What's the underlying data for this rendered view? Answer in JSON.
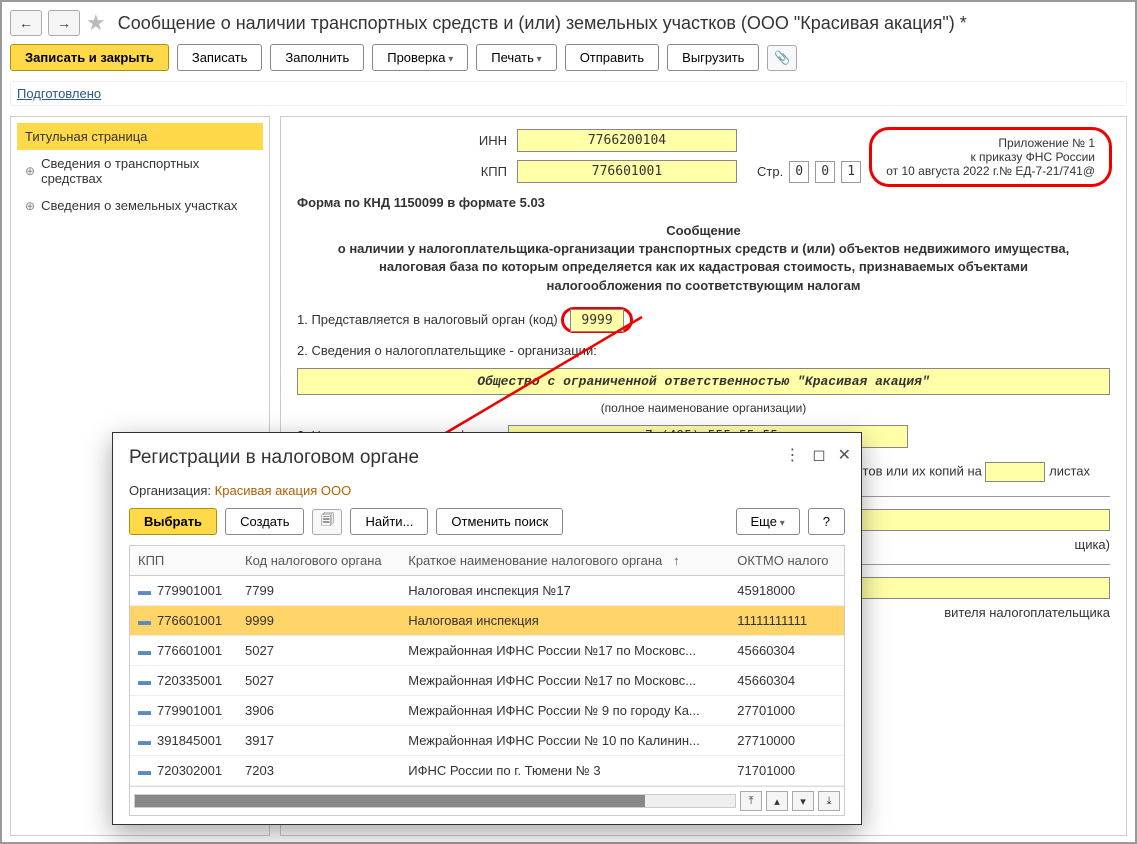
{
  "header": {
    "title": "Сообщение о наличии транспортных средств и (или) земельных участков (ООО \"Красивая акация\") *"
  },
  "toolbar": {
    "save_close": "Записать и закрыть",
    "save": "Записать",
    "fill": "Заполнить",
    "check": "Проверка",
    "print": "Печать",
    "send": "Отправить",
    "export": "Выгрузить"
  },
  "status": "Подготовлено",
  "sidebar": {
    "items": [
      {
        "label": "Титульная страница"
      },
      {
        "label": "Сведения о транспортных средствах"
      },
      {
        "label": "Сведения о земельных участках"
      }
    ]
  },
  "form": {
    "inn_label": "ИНН",
    "inn": "7766200104",
    "kpp_label": "КПП",
    "kpp": "776601001",
    "page_label": "Стр.",
    "page_digits": [
      "0",
      "0",
      "1"
    ],
    "annex": {
      "l1": "Приложение № 1",
      "l2": "к приказу ФНС России",
      "l3": "от 10 августа 2022 г.№ ЕД-7-21/741@"
    },
    "knd": "Форма по КНД 1150099 в формате 5.03",
    "heading": "Сообщение",
    "subtitle": "о наличии у налогоплательщика-организации транспортных средств и (или) объектов недвижимого имущества, налоговая база по которым определяется как их кадастровая стоимость, признаваемых объектами налогообложения по соответствующим налогам",
    "line1_label": "1. Представляется в налоговый орган (код)",
    "tax_code": "9999",
    "line2_label": "2. Сведения о налогоплательщике - организации:",
    "org_full": "Общество с ограниченной ответственностью \"Красивая акация\"",
    "org_note": "(полное наименование организации)",
    "line3_label": "3. Номер контактного телефона",
    "phone": "+7 (495) 555-55-55",
    "sheets_suffix": "нтов или их копий на",
    "sheets_unit": "листах",
    "rep_suffix1": "щика)",
    "rep_suffix2": "вителя налогоплательщика"
  },
  "modal": {
    "title": "Регистрации в налоговом органе",
    "org_label": "Организация:",
    "org_name": "Красивая акация ООО",
    "btn_select": "Выбрать",
    "btn_create": "Создать",
    "btn_find": "Найти...",
    "btn_cancel": "Отменить поиск",
    "btn_more": "Еще",
    "columns": [
      "КПП",
      "Код налогового органа",
      "Краткое наименование налогового органа",
      "ОКТМО налого"
    ],
    "rows": [
      {
        "kpp": "779901001",
        "code": "7799",
        "name": "Налоговая инспекция №17",
        "oktmo": "45918000"
      },
      {
        "kpp": "776601001",
        "code": "9999",
        "name": "Налоговая инспекция",
        "oktmo": "11111111111"
      },
      {
        "kpp": "776601001",
        "code": "5027",
        "name": "Межрайонная ИФНС России №17 по Московс...",
        "oktmo": "45660304"
      },
      {
        "kpp": "720335001",
        "code": "5027",
        "name": "Межрайонная ИФНС России №17 по Московс...",
        "oktmo": "45660304"
      },
      {
        "kpp": "779901001",
        "code": "3906",
        "name": "Межрайонная ИФНС России № 9 по городу Ка...",
        "oktmo": "27701000"
      },
      {
        "kpp": "391845001",
        "code": "3917",
        "name": "Межрайонная ИФНС России № 10 по Калинин...",
        "oktmo": "27710000"
      },
      {
        "kpp": "720302001",
        "code": "7203",
        "name": "ИФНС России по г. Тюмени № 3",
        "oktmo": "71701000"
      }
    ]
  }
}
